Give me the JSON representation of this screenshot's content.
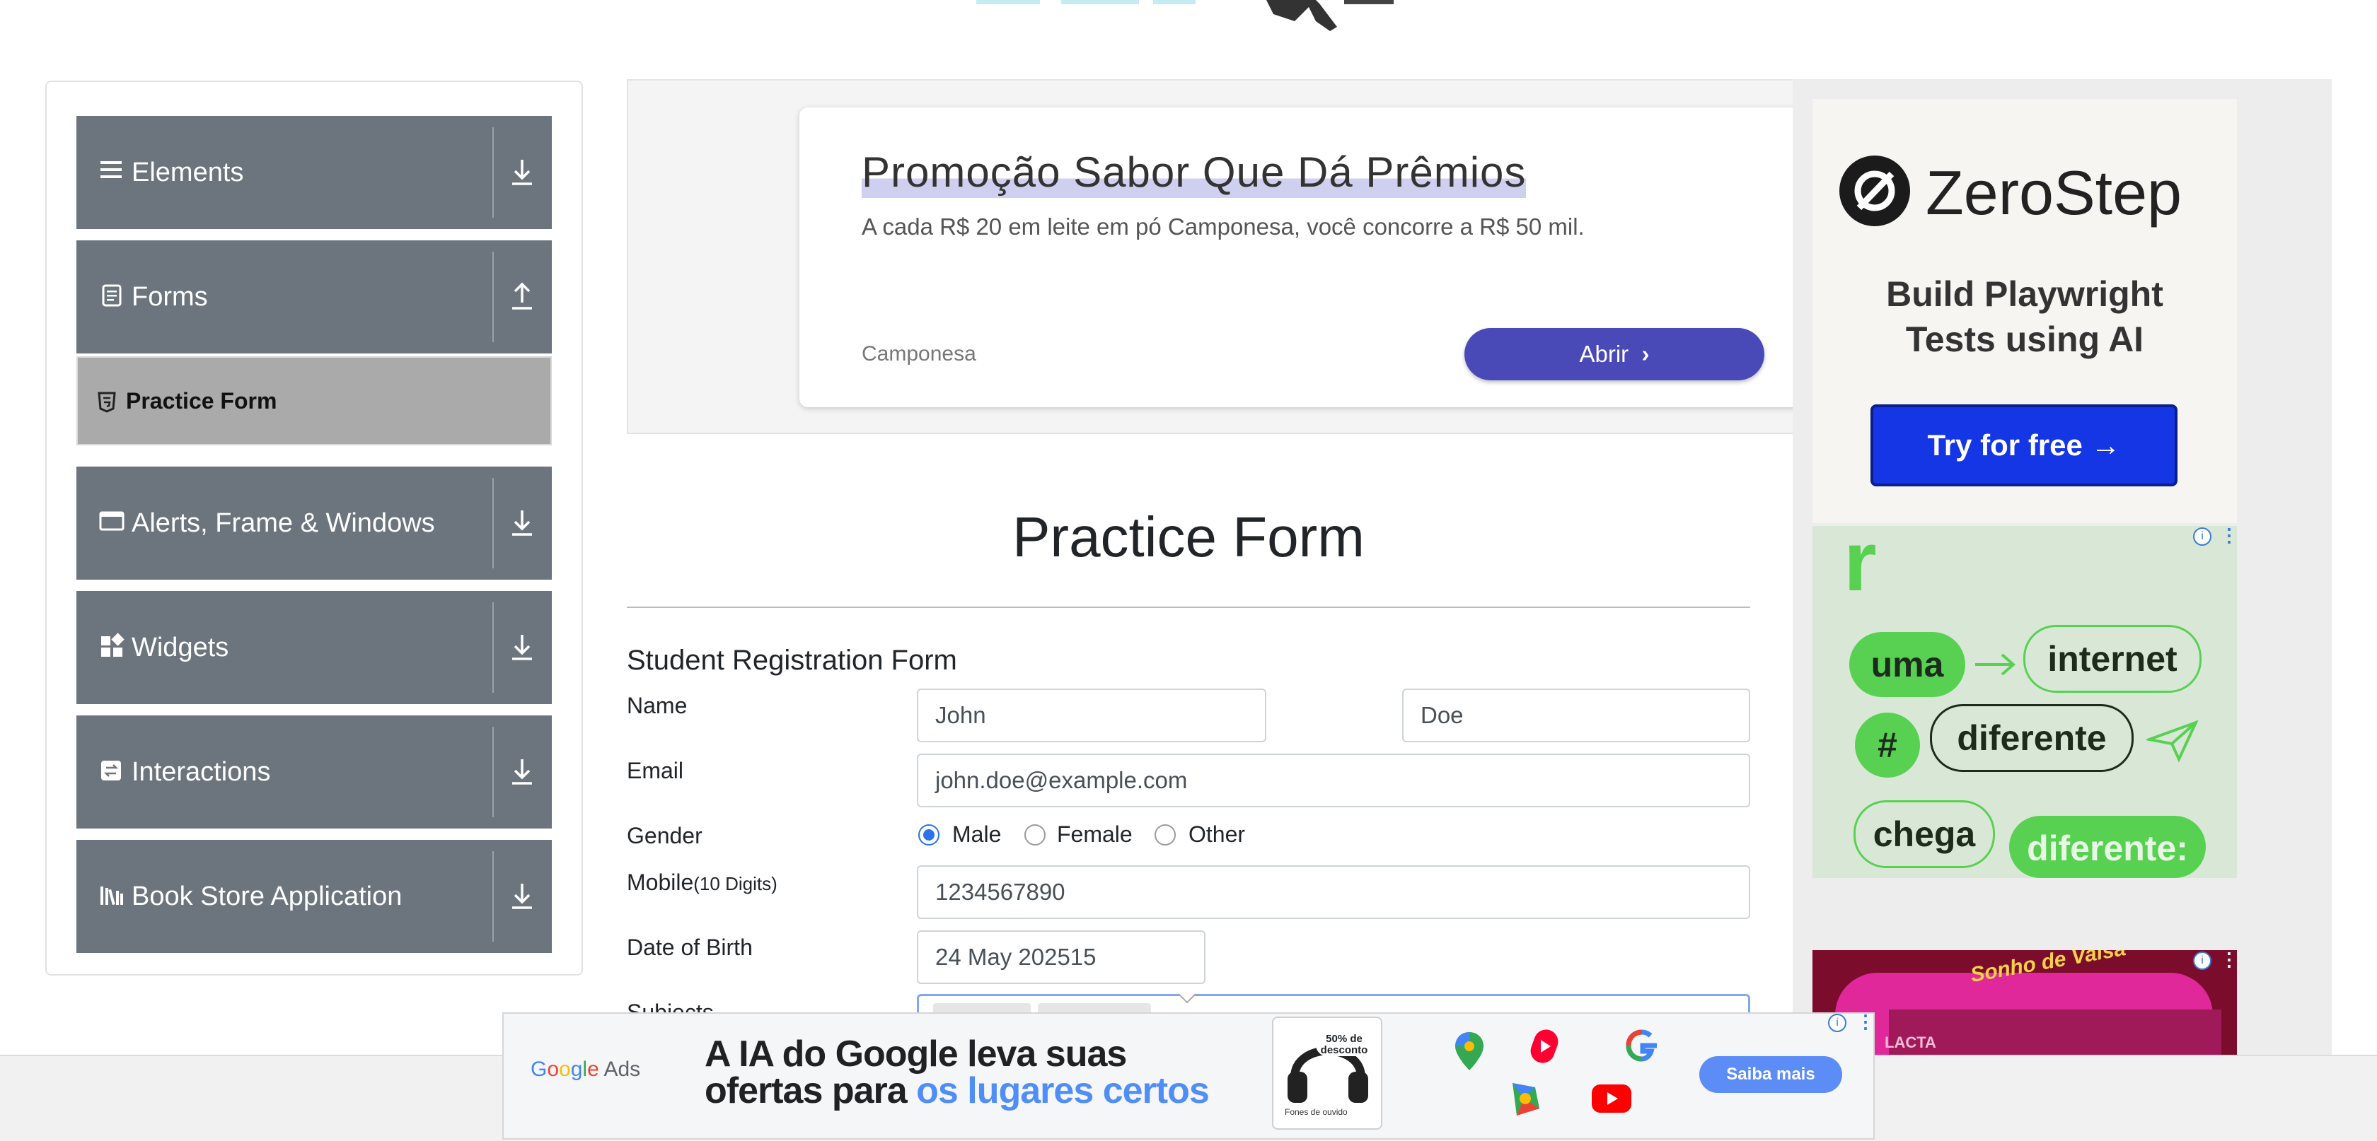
{
  "sidebar": {
    "groups": [
      {
        "label": "Elements",
        "icon": "hamburger-icon",
        "arrow": "download-arrow-icon"
      },
      {
        "label": "Forms",
        "icon": "document-icon",
        "arrow": "upload-arrow-icon"
      },
      {
        "label": "Alerts, Frame & Windows",
        "icon": "window-icon",
        "arrow": "download-arrow-icon"
      },
      {
        "label": "Widgets",
        "icon": "widgets-icon",
        "arrow": "download-arrow-icon"
      },
      {
        "label": "Interactions",
        "icon": "interactions-icon",
        "arrow": "download-arrow-icon"
      },
      {
        "label": "Book Store Application",
        "icon": "library-icon",
        "arrow": "download-arrow-icon"
      }
    ],
    "active_item": {
      "label": "Practice Form",
      "icon": "html5-icon"
    }
  },
  "top_ad": {
    "title": "Promoção Sabor Que Dá Prêmios",
    "description": "A cada R$ 20 em leite em pó Camponesa, você concorre a R$ 50 mil.",
    "advertiser": "Camponesa",
    "button_label": "Abrir"
  },
  "zerostep_ad": {
    "brand": "ZeroStep",
    "tagline_line1": "Build Playwright",
    "tagline_line2": "Tests using AI",
    "button_label": "Try for free →"
  },
  "green_ad": {
    "logo_letter": "r",
    "words": [
      "uma",
      "internet",
      "#",
      "diferente",
      "chega",
      "diferente:"
    ]
  },
  "pink_ad": {
    "brand": "Sonho de Valsa",
    "product": "LACTA"
  },
  "form": {
    "title": "Practice Form",
    "subtitle": "Student Registration Form",
    "labels": {
      "name": "Name",
      "email": "Email",
      "gender": "Gender",
      "mobile": "Mobile",
      "mobile_hint": "(10 Digits)",
      "dob": "Date of Birth",
      "subjects": "Subjects"
    },
    "values": {
      "first_name": "John",
      "last_name": "Doe",
      "email": "john.doe@example.com",
      "mobile": "1234567890",
      "dob": "24 May 202515"
    },
    "gender_options": [
      "Male",
      "Female",
      "Other"
    ],
    "gender_selected": "Male"
  },
  "bottom_ad": {
    "brand_g": [
      "G",
      "o",
      "o",
      "g",
      "l",
      "e"
    ],
    "brand_suffix": "Ads",
    "headline_line1": "A IA do Google leva suas",
    "headline_line2a": "ofertas para ",
    "headline_line2b": "os lugares certos",
    "product_badge": "50% de desconto",
    "product_caption": "Fones de ouvido",
    "button_label": "Saiba mais"
  },
  "colors": {
    "sidebar_group": "#6c757d",
    "active_item": "#aaaaaa",
    "accent_blue": "#2b73e8",
    "ad_button": "#4a49b8",
    "zerostep_button": "#1436e4",
    "green_pill": "#58d152"
  }
}
